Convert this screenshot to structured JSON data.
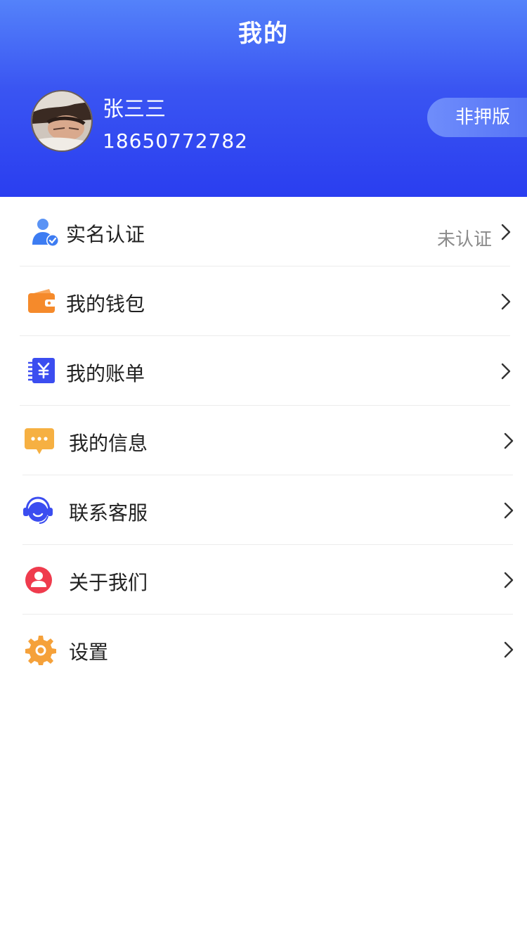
{
  "header": {
    "title": "我的",
    "user_name": "张三三",
    "phone": "18650772782",
    "plan_badge": "非押版",
    "gradient_top": "#5482fa",
    "gradient_bottom": "#2a3ef0"
  },
  "menu": {
    "items": [
      {
        "label": "实名认证",
        "value": "未认证",
        "icon": "verified-user-icon"
      },
      {
        "label": "我的钱包",
        "value": "",
        "icon": "wallet-icon"
      },
      {
        "label": "我的账单",
        "value": "",
        "icon": "bill-icon"
      },
      {
        "label": "我的信息",
        "value": "",
        "icon": "message-icon"
      },
      {
        "label": "联系客服",
        "value": "",
        "icon": "customer-service-icon"
      },
      {
        "label": "关于我们",
        "value": "",
        "icon": "about-us-icon"
      },
      {
        "label": "设置",
        "value": "",
        "icon": "settings-gear-icon"
      }
    ]
  },
  "colors": {
    "wallet": "#f58a2b",
    "bill": "#3b4df0",
    "message": "#f6b042",
    "customer_service": "#3b4df0",
    "about": "#ef3b4d",
    "settings": "#f5a13a",
    "verified": "#3d7cf2"
  }
}
